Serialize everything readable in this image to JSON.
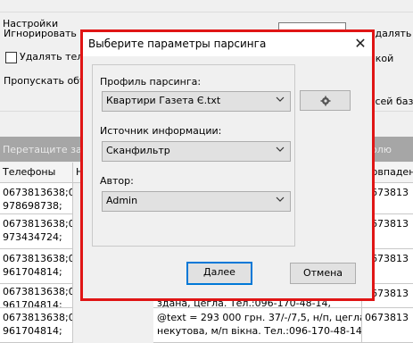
{
  "background": {
    "group_title": "Настройки",
    "ignore_label": "Игнорировать гр",
    "delete_label": "Удалять теле",
    "skip_label": "Пропускать объяв",
    "right_code_label": "удалять код",
    "right_label2": "окой",
    "right_label3": "всей базе",
    "drag_hint": "Перетащите заго",
    "drag_right": "олю",
    "columns": [
      "Телефоны",
      "Н",
      "Совпаден"
    ],
    "rows": [
      {
        "phones": "0673813638;0\n978698738;",
        "right": "0673813"
      },
      {
        "phones": "0673813638;0\n973434724;",
        "right": "0673813"
      },
      {
        "phones": "0673813638;0\n961704814;",
        "right": "0673813"
      },
      {
        "phones": "0673813638;0\n961704814;",
        "mid": "здана, цегла. Тел.:096-170-48-14,",
        "right": "0673813"
      },
      {
        "phones": "0673813638;0\n961704814;",
        "mid": "@text = 293 000 грн. 37/-/7,5, н/п, цегла,\nнекутова, м/п вікна. Тел.:096-170-48-14,",
        "right": "0673813"
      }
    ]
  },
  "dialog": {
    "title": "Выберите параметры парсинга",
    "close_symbol": "✕",
    "profile_label": "Профиль парсинга:",
    "profile_value": "Квартири Газета Є.txt",
    "source_label": "Источник информации:",
    "source_value": "Сканфильтр",
    "author_label": "Автор:",
    "author_value": "Admin",
    "settings_icon": "gear-icon",
    "next_button": "Далее",
    "cancel_button": "Отмена",
    "highlight_color": "#e01515"
  }
}
